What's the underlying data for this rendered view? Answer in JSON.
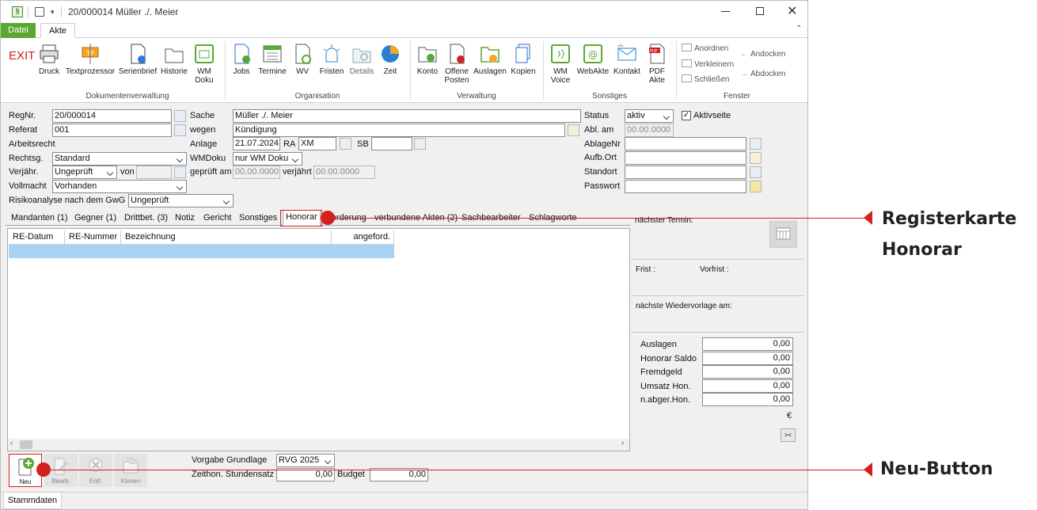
{
  "window": {
    "title": "20/000014 Müller ./. Meier"
  },
  "menu": {
    "tab_file": "Datei",
    "tab_akte": "Akte"
  },
  "ribbon": {
    "exit": "EXIT",
    "doc_buttons": [
      "Druck",
      "Textprozessor",
      "Serienbrief",
      "Historie",
      "WM Doku"
    ],
    "doc_group": "Dokumentenverwaltung",
    "org_buttons": [
      "Jobs",
      "Termine",
      "WV",
      "Fristen",
      "Details",
      "Zeit"
    ],
    "org_group": "Organisation",
    "verw_buttons": [
      "Konto",
      "Offene Posten",
      "Auslagen",
      "Kopien"
    ],
    "verw_group": "Verwaltung",
    "sonst_buttons": [
      "WM Voice",
      "WebAkte",
      "Kontakt",
      "PDF Akte"
    ],
    "sonst_group": "Sonstiges",
    "fenster_buttons": [
      "Anordnen",
      "Verkleinern",
      "Schließen"
    ],
    "fenster_dock": [
      "Andocken",
      "Abdocken"
    ],
    "fenster_group": "Fenster"
  },
  "form": {
    "regnr_label": "RegNr.",
    "regnr": "20/000014",
    "referat_label": "Referat",
    "referat": "001",
    "arbeitsrecht": "Arbeitsrecht",
    "rechtsg_label": "Rechtsg.",
    "rechtsg": "Standard",
    "verjaehr_label": "Verjähr.",
    "verjaehr": "Ungeprüft",
    "von_label": "von",
    "vollmacht_label": "Vollmacht",
    "vollmacht": "Vorhanden",
    "risiko_label": "Risikoanalyse nach dem GwG",
    "risiko": "Ungeprüft",
    "sache_label": "Sache",
    "sache": "Müller ./. Meier",
    "wegen_label": "wegen",
    "wegen": "Kündigung",
    "anlage_label": "Anlage",
    "anlage": "21.07.2024",
    "ra_label": "RA",
    "ra": "XM",
    "sb_label": "SB",
    "wmdoku_label": "WMDoku",
    "wmdoku": "nur WM Doku",
    "geprueft_label": "geprüft am",
    "geprueft": "00.00.0000",
    "verjaehrt_label": "verjährt",
    "verjaehrt": "00.00.0000",
    "status_label": "Status",
    "status": "aktiv",
    "aktivseite": "Aktivseite",
    "ablam_label": "Abl. am",
    "ablam": "00.00.0000",
    "ablagenr_label": "AblageNr",
    "aufbort_label": "Aufb.Ort",
    "standort_label": "Standort",
    "passwort_label": "Passwort"
  },
  "tabs": [
    "Mandanten (1)",
    "Gegner (1)",
    "Drittbet. (3)",
    "Notiz",
    "Gericht",
    "Sonstiges",
    "Honorar",
    "Forderung",
    "verbundene Akten (2)",
    "Sachbearbeiter",
    "Schlagworte"
  ],
  "grid": {
    "columns": [
      "RE-Datum",
      "RE-Nummer",
      "Bezeichnung",
      "angeford."
    ]
  },
  "bottom": {
    "neu": "Neu",
    "bearb": "Bearb.",
    "entf": "Entf.",
    "klonen": "Klonen",
    "vorgabe_label": "Vorgabe Grundlage",
    "vorgabe": "RVG 2025",
    "zeithon_label": "Zeithon. Stundensatz",
    "zeithon": "0,00",
    "budget_label": "Budget",
    "budget": "0,00"
  },
  "side": {
    "termin": "nächster Termin:",
    "frist": "Frist :",
    "vorfrist": "Vorfrist :",
    "wiedervorlage": "nächste Wiedervorlage am:",
    "sums": [
      {
        "label": "Auslagen",
        "value": "0,00"
      },
      {
        "label": "Honorar Saldo",
        "value": "0,00"
      },
      {
        "label": "Fremdgeld",
        "value": "0,00"
      },
      {
        "label": "Umsatz Hon.",
        "value": "0,00"
      },
      {
        "label": "n.abger.Hon.",
        "value": "0,00"
      }
    ],
    "currency": "€",
    "collapse": "><"
  },
  "status_tab": "Stammdaten",
  "callouts": {
    "honorar_line1": "Registerkarte",
    "honorar_line2": "Honorar",
    "neu": "Neu-Button"
  },
  "colors": {
    "accent_green": "#5aa832",
    "select_blue": "#a9d3f5",
    "callout_red": "#d42020"
  }
}
